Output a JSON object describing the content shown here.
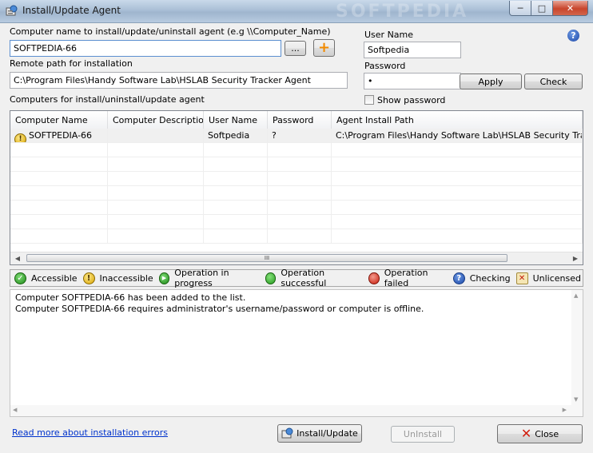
{
  "window": {
    "title": "Install/Update Agent",
    "watermark": "SOFTPEDIA",
    "buttons": {
      "minimize": "─",
      "maximize": "□",
      "close": "✕"
    }
  },
  "form": {
    "computer_label": "Computer name to install/update/uninstall agent (e.g \\\\Computer_Name)",
    "computer_value": "SOFTPEDIA-66",
    "browse_label": "...",
    "add_label": "+",
    "remote_path_label": "Remote path for installation",
    "remote_path_value": "C:\\Program Files\\Handy Software Lab\\HSLAB Security Tracker Agent",
    "computers_label": "Computers for install/uninstall/update agent",
    "username_label": "User Name",
    "username_value": "Softpedia",
    "password_label": "Password",
    "password_value": "•",
    "apply_label": "Apply",
    "check_label": "Check",
    "show_password_label": "Show password",
    "help_icon": "?"
  },
  "table": {
    "columns": [
      "Computer Name",
      "Computer Description",
      "User Name",
      "Password",
      "Agent Install Path"
    ],
    "rows": [
      {
        "status_icon": "!",
        "computer": "SOFTPEDIA-66",
        "description": "",
        "user": "Softpedia",
        "password": "?",
        "path": "C:\\Program Files\\Handy Software Lab\\HSLAB Security Tracker Agent"
      }
    ],
    "scroll_grip": "III",
    "scroll_left": "◀",
    "scroll_right": "▶"
  },
  "legend": [
    {
      "icon": "green-check-icon",
      "glyph": "✓",
      "label": "Accessible"
    },
    {
      "icon": "warning-icon",
      "glyph": "!",
      "label": "Inaccessible"
    },
    {
      "icon": "play-icon",
      "glyph": "▶",
      "label": "Operation in progress"
    },
    {
      "icon": "green-dot-icon",
      "glyph": "",
      "label": "Operation successful"
    },
    {
      "icon": "red-dot-icon",
      "glyph": "",
      "label": "Operation failed"
    },
    {
      "icon": "question-icon",
      "glyph": "?",
      "label": "Checking"
    },
    {
      "icon": "unlicensed-icon",
      "glyph": "✕",
      "label": "Unlicensed"
    }
  ],
  "log": {
    "lines": [
      "Computer SOFTPEDIA-66 has been added to the list.",
      "Computer SOFTPEDIA-66 requires administrator's username/password or computer is offline."
    ],
    "scroll_up": "▲",
    "scroll_down": "▼",
    "scroll_left": "◀",
    "scroll_right": "▶"
  },
  "footer": {
    "link_label": "Read more about installation errors",
    "install_label": "Install/Update",
    "uninstall_label": "UnInstall",
    "close_label": "Close",
    "close_glyph": "✕"
  },
  "colors": {
    "link": "#0033cc",
    "title_bar": "#aabfd6",
    "close_button": "#c8452c"
  }
}
